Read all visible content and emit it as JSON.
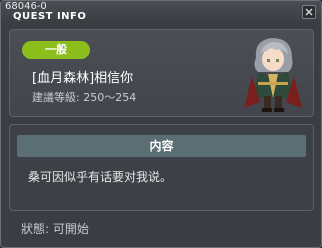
{
  "window": {
    "quest_id": "68046-0",
    "title": "QUEST INFO"
  },
  "quest": {
    "category_badge": "一般",
    "name": "[血月森林]相信你",
    "level_requirement": "建議等級: 250～254",
    "npc_image": "npc-portrait-gray-haired-knight"
  },
  "content": {
    "header": "内容",
    "text": "桑可因似乎有话要对我说。"
  },
  "status": {
    "text": "狀態: 可開始"
  },
  "colors": {
    "badge": "#8cbf1c",
    "content_header": "#5a6e74",
    "panel": "#3a3d42"
  }
}
